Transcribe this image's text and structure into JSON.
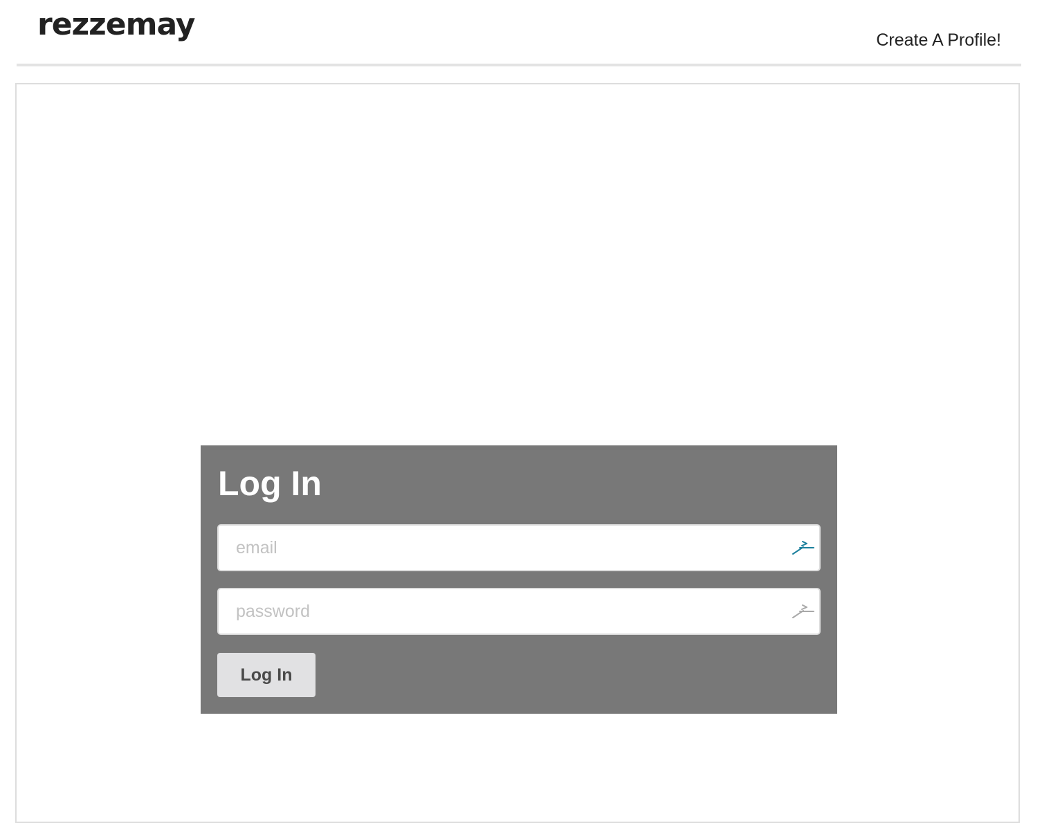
{
  "header": {
    "logo_text": "rezzemay",
    "create_profile_link": "Create A Profile!"
  },
  "login": {
    "title": "Log In",
    "email_placeholder": "email",
    "password_placeholder": "password",
    "button_label": "Log In"
  },
  "icons": {
    "email_field_icon": "password-manager-icon",
    "password_field_icon": "password-manager-icon"
  },
  "colors": {
    "panel_bg": "#787878",
    "email_icon": "#1a7f9c",
    "password_icon": "#a8a8a8"
  }
}
